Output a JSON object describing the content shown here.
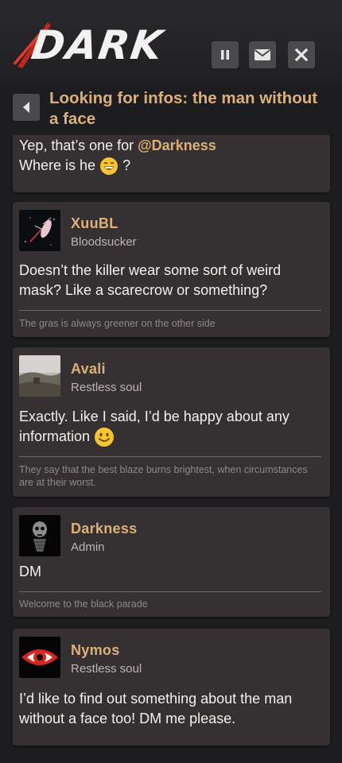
{
  "app": {
    "logo_text": "DARK"
  },
  "header": {
    "buttons": [
      {
        "name": "pause",
        "icon": "pause-icon"
      },
      {
        "name": "messages",
        "icon": "envelope-icon"
      },
      {
        "name": "close",
        "icon": "close-icon"
      }
    ]
  },
  "thread": {
    "back_icon": "chevron-left-icon",
    "title": "Looking for infos: the man without a face"
  },
  "posts": [
    {
      "partial": true,
      "line1_prefix": "Yep, that’s one for ",
      "mention": "@Darkness",
      "line2_prefix": "Where is he",
      "line2_suffix": " ?",
      "emoji": "grinning-emoji"
    },
    {
      "user": "XuuBL",
      "rank": "Bloodsucker",
      "message": "Doesn’t the killer wear some sort of weird mask? Like a scarecrow or something?",
      "signature": "The gras is always greener on the other side"
    },
    {
      "user": "Avali",
      "rank": "Restless soul",
      "message_text": "Exactly. Like I said, I’d be happy about any information",
      "emoji": "smiling-emoji",
      "signature": "They say that the best blaze burns brightest, when circumstances are at their worst."
    },
    {
      "user": "Darkness",
      "rank": "Admin",
      "message": "DM",
      "signature": "Welcome to the black parade"
    },
    {
      "user": "Nymos",
      "rank": "Restless soul",
      "message": "I’d like to find out something about the man without a face too! DM me please."
    }
  ],
  "colors": {
    "accent": "#dcb07a",
    "background": "#1d1c1e",
    "card": "#353133",
    "button": "#4a494b"
  }
}
